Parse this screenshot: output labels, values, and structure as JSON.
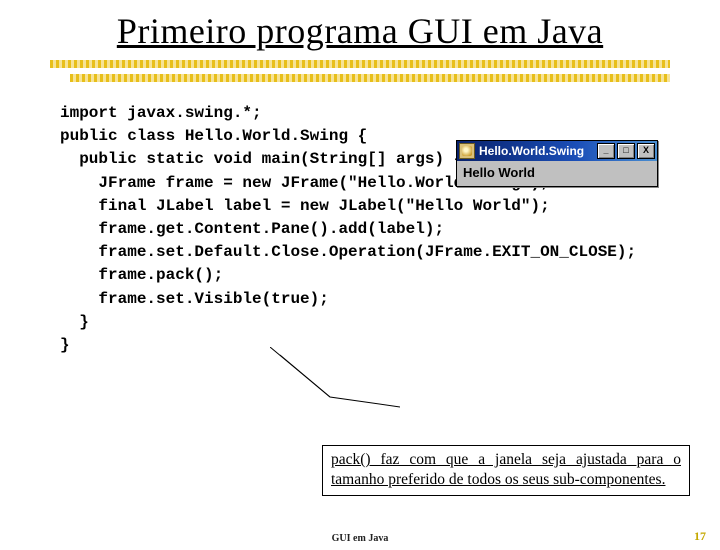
{
  "title": "Primeiro programa GUI em Java",
  "code_block": "import javax.swing.*;\npublic class Hello.World.Swing {\n  public static void main(String[] args) {\n    JFrame frame = new JFrame(\"Hello.World.Swing\");\n    final JLabel label = new JLabel(\"Hello World\");\n    frame.get.Content.Pane().add(label);\n    frame.set.Default.Close.Operation(JFrame.EXIT_ON_CLOSE);\n    frame.pack();\n    frame.set.Visible(true);\n  }\n}",
  "window": {
    "title": "Hello.World.Swing",
    "body": "Hello World",
    "buttons": {
      "min": "_",
      "max": "□",
      "close": "X"
    }
  },
  "callout_text": "pack() faz com que a janela seja ajustada para o tamanho preferido de todos os seus sub-componentes.",
  "footer": "GUI em Java",
  "page_number": "17"
}
